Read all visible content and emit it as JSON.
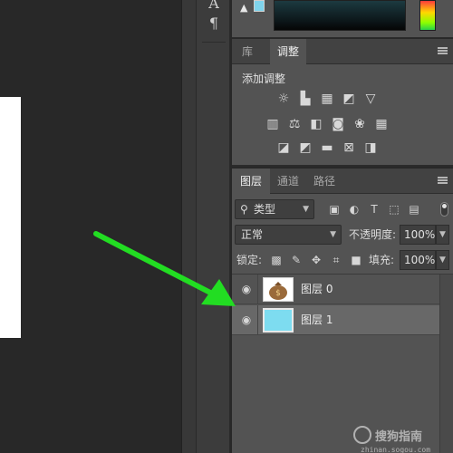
{
  "tools": [
    "A",
    "¶"
  ],
  "adjust_panel": {
    "tabs": [
      {
        "label": "库"
      },
      {
        "label": "调整"
      }
    ],
    "add_label": "添加调整",
    "icons": [
      "brightness-contrast-icon",
      "levels-icon",
      "curves-icon",
      "exposure-icon",
      "vibrance-icon",
      "hue-saturation-icon",
      "color-balance-icon",
      "black-white-icon",
      "photo-filter-icon",
      "channel-mixer-icon",
      "color-lookup-icon",
      "invert-icon",
      "posterize-icon",
      "threshold-icon",
      "gradient-map-icon",
      "selective-color-icon"
    ]
  },
  "layers_panel": {
    "tabs": [
      {
        "label": "图层"
      },
      {
        "label": "通道"
      },
      {
        "label": "路径"
      }
    ],
    "filter_type": "类型",
    "blend_mode": "正常",
    "opacity_label": "不透明度:",
    "opacity_value": "100%",
    "lock_label": "锁定:",
    "fill_label": "填充:",
    "fill_value": "100%",
    "layers": [
      {
        "name": "图层 0",
        "selected": false
      },
      {
        "name": "图层 1",
        "selected": true
      }
    ]
  },
  "annotation": {
    "arrow_color": "#22dd22"
  },
  "watermark": {
    "title": "搜狗指南",
    "url": "zhinan.sogou.com"
  }
}
